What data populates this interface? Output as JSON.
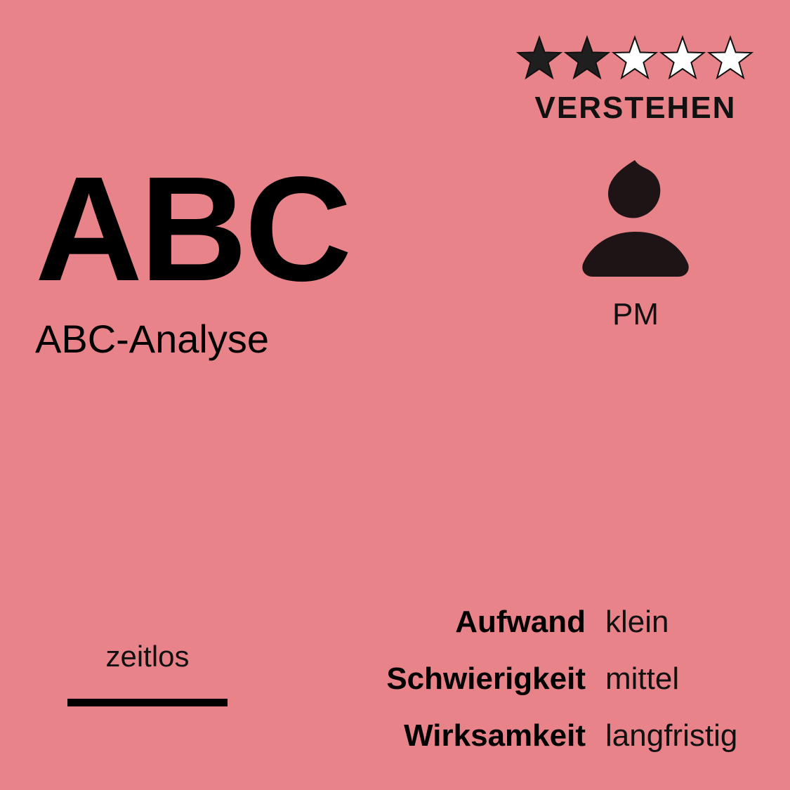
{
  "rating": {
    "value": 2,
    "max": 5,
    "filled_color": "#1f1f1f",
    "empty_color": "#ffffff",
    "icon": "star-icon"
  },
  "category": "VERSTEHEN",
  "abbreviation": "ABC",
  "full_name": "ABC-Analyse",
  "role": {
    "icon": "person-icon",
    "label": "PM"
  },
  "timeframe": "zeitlos",
  "attributes": [
    {
      "key": "Aufwand",
      "value": "klein"
    },
    {
      "key": "Schwierigkeit",
      "value": "mittel"
    },
    {
      "key": "Wirksamkeit",
      "value": "langfristig"
    }
  ],
  "colors": {
    "background": "#e8838a",
    "text": "#000000"
  }
}
